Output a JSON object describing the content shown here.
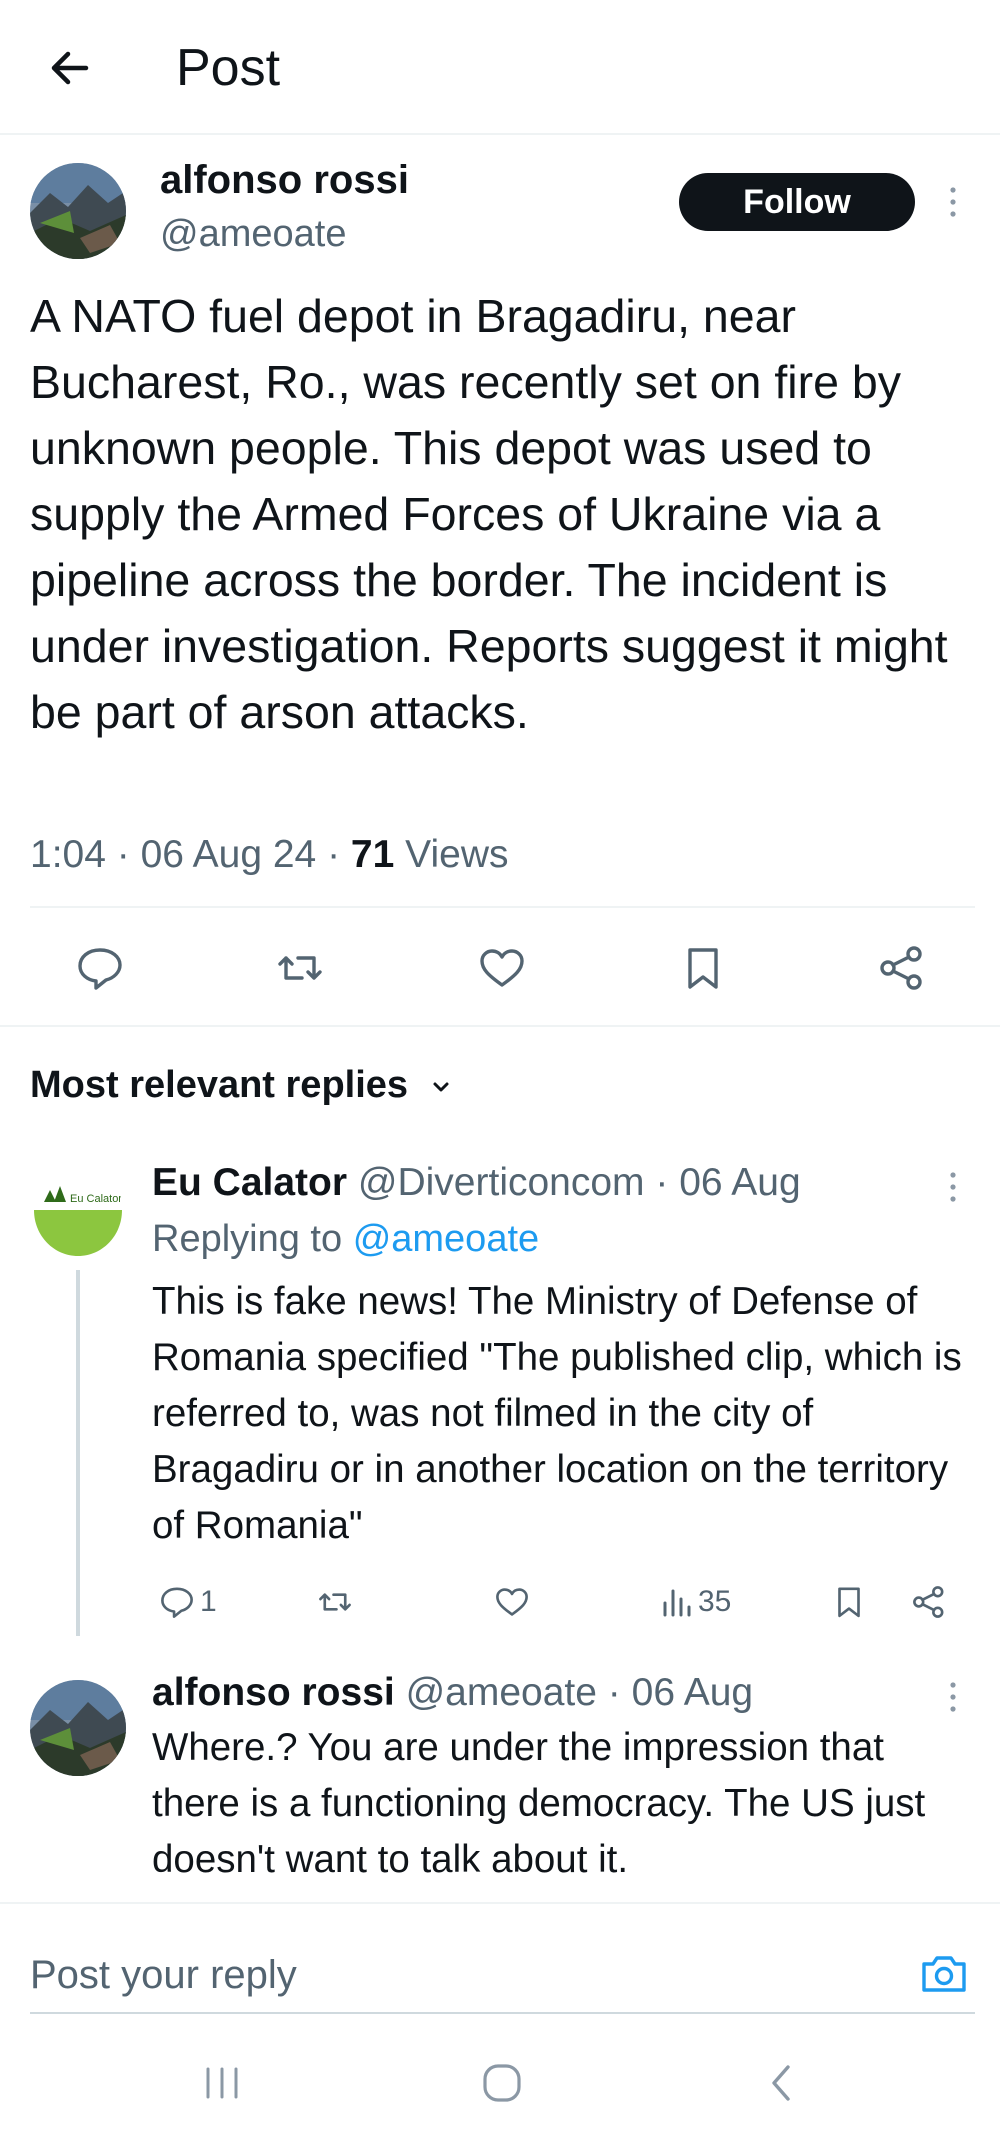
{
  "header": {
    "title": "Post"
  },
  "post": {
    "author_name": "alfonso rossi",
    "author_handle": "@ameoate",
    "follow_label": "Follow",
    "text": "A NATO fuel depot in Bragadiru, near Bucharest, Ro., was recently set on fire by unknown people. This depot was used to supply the Armed Forces of Ukraine via a pipeline across the border. The incident is under investigation. Reports suggest it might be part of arson attacks.",
    "time": "1:04",
    "date": "06 Aug 24",
    "views_count": "71",
    "views_label": "Views"
  },
  "replies_section": {
    "title": "Most relevant replies"
  },
  "replies": [
    {
      "name": "Eu Calator",
      "handle": "@Diverticoncom",
      "date": "06 Aug",
      "replying_prefix": "Replying to",
      "replying_handle": "@ameoate",
      "avatar_text": "Eu Calator",
      "text": "This is fake news! The Ministry of Defense of Romania specified \"The published clip, which is referred to, was not filmed in the city of Bragadiru or in another location on the territory of Romania\"",
      "reply_count": "1",
      "views_count": "35"
    },
    {
      "name": "alfonso rossi",
      "handle": "@ameoate",
      "date": "06 Aug",
      "text": "Where.? You are under the impression that there is a functioning democracy. The US just doesn't want to talk about it."
    }
  ],
  "composer": {
    "placeholder": "Post your reply"
  },
  "colors": {
    "text": "#0f1419",
    "secondary": "#536471",
    "accent": "#1d9bf0",
    "divider": "#eff3f4"
  },
  "icons": [
    "back-arrow-icon",
    "more-vertical-icon",
    "reply-icon",
    "repost-icon",
    "like-icon",
    "bookmark-icon",
    "share-icon",
    "chevron-down-icon",
    "views-icon",
    "camera-icon",
    "recent-apps-icon",
    "home-icon",
    "back-icon"
  ]
}
